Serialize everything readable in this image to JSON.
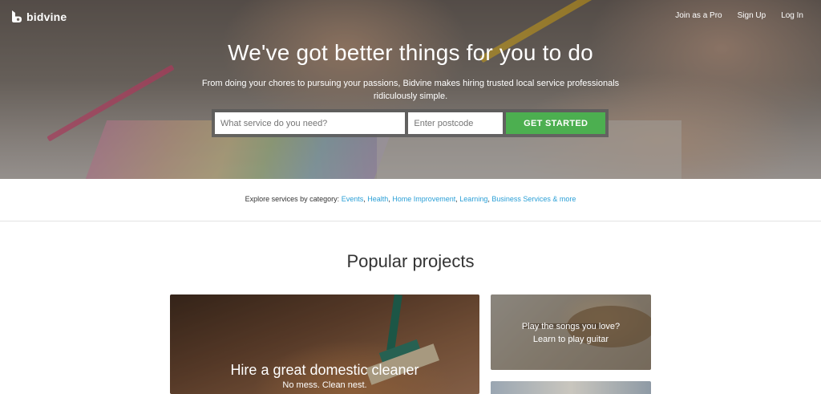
{
  "brand": {
    "name": "bidvine",
    "logo_icon": "bidvine-logo-icon"
  },
  "nav": {
    "items": [
      "Join as a Pro",
      "Sign Up",
      "Log In"
    ]
  },
  "hero": {
    "title": "We've got better things for you to do",
    "subtitle": "From doing your chores to pursuing your passions, Bidvine makes hiring trusted local service professionals ridiculously simple.",
    "service_placeholder": "What service do you need?",
    "postcode_placeholder": "Enter postcode",
    "cta_label": "GET STARTED"
  },
  "explore": {
    "prefix": "Explore services by category:",
    "categories": [
      "Events",
      "Health",
      "Home Improvement",
      "Learning",
      "Business Services & more"
    ]
  },
  "popular": {
    "title": "Popular projects",
    "cards": [
      {
        "title": "Hire a great domestic cleaner",
        "subtitle": "No mess. Clean nest."
      },
      {
        "line1": "Play the songs you love?",
        "line2": "Learn to play guitar"
      }
    ]
  },
  "colors": {
    "accent_green": "#4caf50",
    "link_blue": "#2a9fd6"
  }
}
